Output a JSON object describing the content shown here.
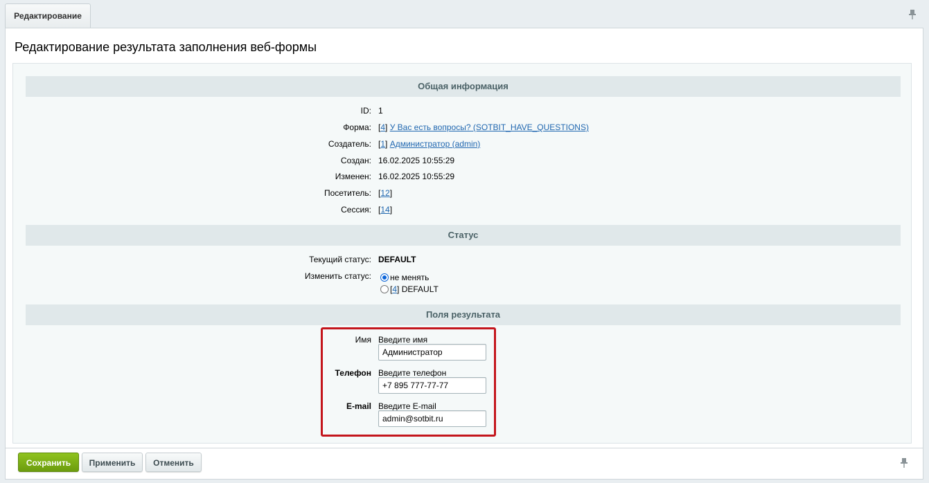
{
  "tab": {
    "label": "Редактирование"
  },
  "page_title": "Редактирование результата заполнения веб-формы",
  "sections": {
    "general": "Общая информация",
    "status": "Статус",
    "fields": "Поля результата"
  },
  "general": {
    "id_label": "ID:",
    "id_value": "1",
    "form_label": "Форма:",
    "form_id": "4",
    "form_name": "У Вас есть вопросы? (SOTBIT_HAVE_QUESTIONS)",
    "creator_label": "Создатель:",
    "creator_id": "1",
    "creator_name": "Администратор (admin)",
    "created_label": "Создан:",
    "created_value": "16.02.2025 10:55:29",
    "modified_label": "Изменен:",
    "modified_value": "16.02.2025 10:55:29",
    "visitor_label": "Посетитель:",
    "visitor_id": "12",
    "session_label": "Сессия:",
    "session_id": "14"
  },
  "status": {
    "current_label": "Текущий статус:",
    "current_value": "DEFAULT",
    "change_label": "Изменить статус:",
    "option_keep": "не менять",
    "option_default_id": "4",
    "option_default_name": "DEFAULT"
  },
  "fields": {
    "name_label": "Имя",
    "name_hint": "Введите имя",
    "name_value": "Администратор",
    "phone_label": "Телефон",
    "phone_hint": "Введите телефон",
    "phone_value": "+7 895 777-77-77",
    "email_label": "E-mail",
    "email_hint": "Введите E-mail",
    "email_value": "admin@sotbit.ru"
  },
  "buttons": {
    "save": "Сохранить",
    "apply": "Применить",
    "cancel": "Отменить"
  },
  "colors": {
    "save_button": "#7ab51d",
    "link": "#2067b0",
    "highlight_border": "#c4151c",
    "section_header_bg": "#e0e8ea"
  },
  "icons": {
    "pin": "pin-icon"
  }
}
